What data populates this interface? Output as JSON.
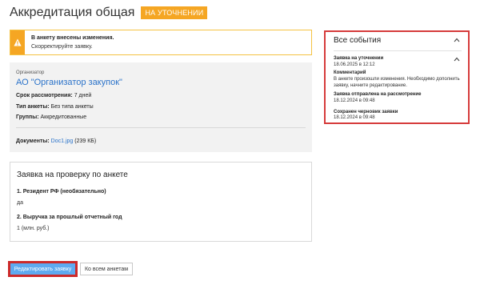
{
  "header": {
    "title": "Аккредитация общая",
    "status": "НА УТОЧНЕНИИ",
    "status_color": "#f5a623"
  },
  "alert": {
    "icon": "warning-icon",
    "title": "В анкету внесены изменения.",
    "text": "Скорректируйте заявку."
  },
  "organizer": {
    "label": "Организатор",
    "name": "АО \"Организатор закупок\"",
    "review_label": "Срок рассмотрения:",
    "review_value": " 7 дней",
    "type_label": "Тип анкеты:",
    "type_value": " Без типа анкеты",
    "groups_label": "Группы:",
    "groups_value": " Аккредитованные",
    "docs_label": "Документы:",
    "doc_name": "Doc1.jpg",
    "doc_size": " (239 КБ)"
  },
  "form": {
    "title": "Заявка на проверку по анкете",
    "questions": [
      {
        "label": "1. Резидент РФ (необязательно)",
        "answer": "да"
      },
      {
        "label": "2. Выручка за прошлый отчетный год",
        "answer": "1 (млн. руб.)"
      }
    ]
  },
  "buttons": {
    "edit": "Редактировать заявку",
    "all": "Ко всем анкетам"
  },
  "events": {
    "title": "Все события",
    "items": [
      {
        "title": "Заявка на уточнении",
        "date": "18.06.2025 в 12:12"
      },
      {
        "title": "Комментарий",
        "text": "В анкете произошли изменения. Необходимо дополнить заявку, начните редактирование."
      },
      {
        "title": "Заявка отправлена на рассмотрение",
        "date": "18.12.2024 в 09:48"
      },
      {
        "title": "Сохранен черновик заявки",
        "date": "18.12.2024 в 09:48"
      }
    ]
  }
}
